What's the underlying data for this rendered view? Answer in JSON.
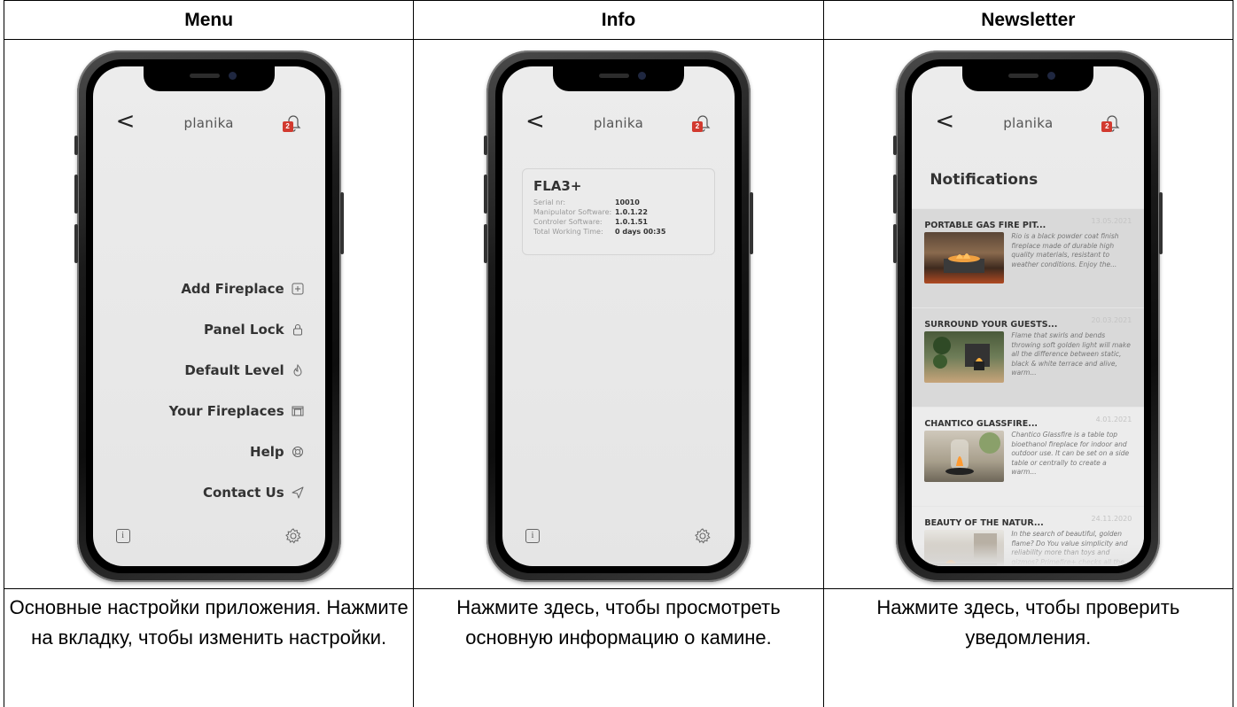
{
  "columns": [
    {
      "header": "Menu",
      "caption": "Основные настройки приложения. Нажмите на вкладку, чтобы изменить настройки.",
      "brand": "planika",
      "back_symbol": "<",
      "badge": "2",
      "menu_items": [
        {
          "label": "Add Fireplace",
          "icon": "plus-square-icon"
        },
        {
          "label": "Panel Lock",
          "icon": "lock-icon"
        },
        {
          "label": "Default Level",
          "icon": "flame-icon"
        },
        {
          "label": "Your Fireplaces",
          "icon": "fireplace-icon"
        },
        {
          "label": "Help",
          "icon": "lifebuoy-icon"
        },
        {
          "label": "Contact Us",
          "icon": "send-icon"
        }
      ],
      "info_symbol": "i"
    },
    {
      "header": "Info",
      "caption": "Нажмите здесь, чтобы просмотреть основную информацию о камине.",
      "brand": "planika",
      "back_symbol": "<",
      "badge": "2",
      "info_card": {
        "model": "FLA3+",
        "rows": [
          {
            "key": "Serial nr:",
            "value": "10010"
          },
          {
            "key": "Manipulator Software:",
            "value": "1.0.1.22"
          },
          {
            "key": "Controler Software:",
            "value": "1.0.1.51"
          },
          {
            "key": "Total Working Time:",
            "value": "0 days  00:35"
          }
        ]
      },
      "info_symbol": "i"
    },
    {
      "header": "Newsletter",
      "caption": "Нажмите здесь, чтобы проверить уведомления.",
      "brand": "planika",
      "back_symbol": "<",
      "badge": "2",
      "notifications_title": "Notifications",
      "notifications": [
        {
          "title": "PORTABLE GAS FIRE PIT...",
          "date": "13.05.2021",
          "text": "Rio is a black powder coat finish fireplace made of durable high quality materials, resistant to weather conditions. Enjoy the..."
        },
        {
          "title": "SURROUND YOUR GUESTS...",
          "date": "20.03.2021",
          "text": "Flame that swirls and bends throwing soft golden light will make all the difference between static, black & white terrace and alive, warm..."
        },
        {
          "title": "CHANTICO GLASSFIRE...",
          "date": "4.01.2021",
          "text": "Chantico Glassfire is a table top bioethanol fireplace for indoor and outdoor use. It can be set on a side table or centrally to create a warm..."
        },
        {
          "title": "BEAUTY OF THE NATUR...",
          "date": "24.11.2020",
          "text": "In the search of beautiful, golden flame? Do You value simplicity and reliability more than toys and gizmos? Primefire+ checks all the ..."
        }
      ]
    }
  ]
}
